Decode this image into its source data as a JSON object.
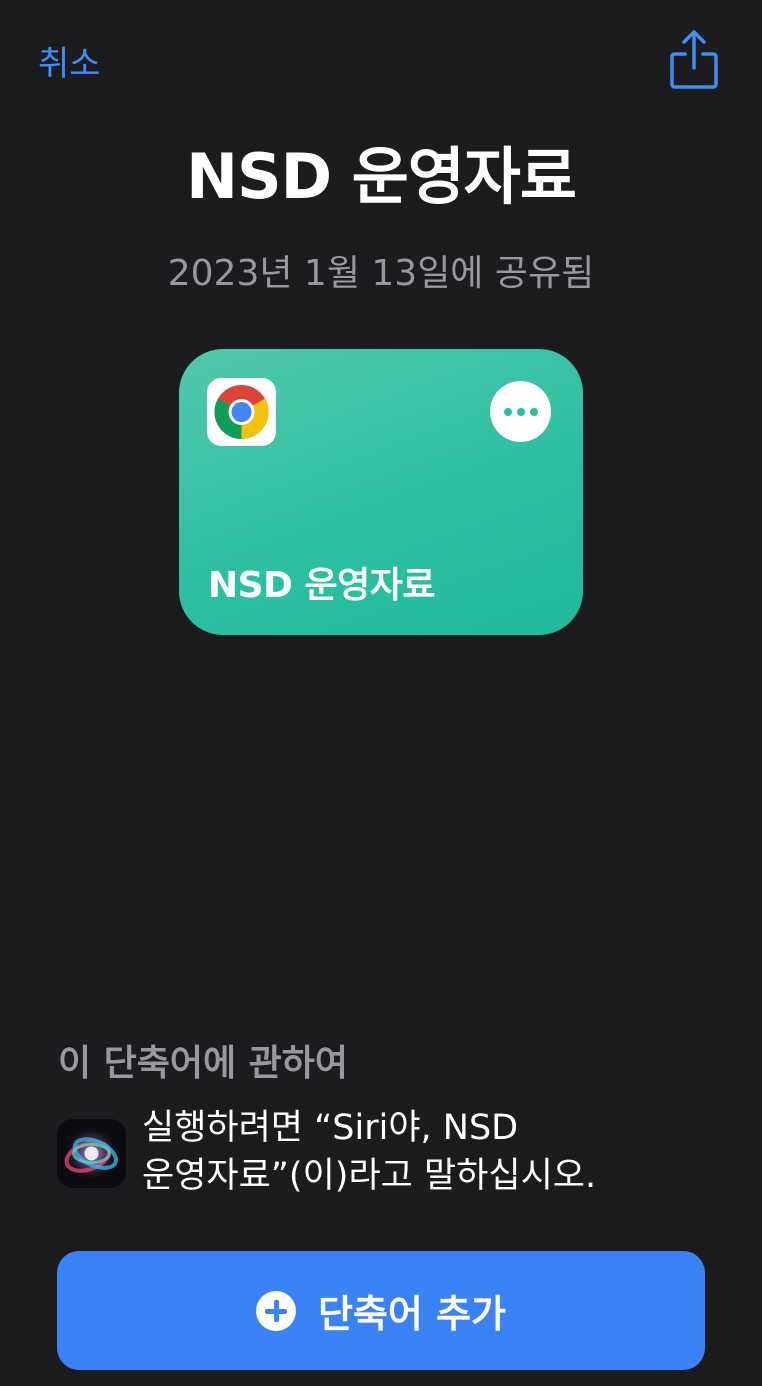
{
  "nav": {
    "cancel_label": "취소",
    "share_icon": "share-icon"
  },
  "header": {
    "title": "NSD 운영자료",
    "shared_date": "2023년 1월 13일에 공유됨"
  },
  "shortcut_card": {
    "app_icon": "chrome-icon",
    "more_icon": "ellipsis-icon",
    "label": "NSD 운영자료",
    "colors": {
      "gradient_start": "#52c8ac",
      "gradient_end": "#20bb9c"
    }
  },
  "about": {
    "heading": "이 단축어에 관하여",
    "siri_icon": "siri-icon",
    "siri_line1": "실행하려면 “Siri야, NSD",
    "siri_line2": "운영자료”(이)라고 말하십시오."
  },
  "add_button": {
    "icon": "plus-circle-icon",
    "label": "단축어 추가"
  },
  "colors": {
    "accent": "#3d8ef7",
    "background": "#1c1c1e",
    "button": "#3a82f6"
  }
}
